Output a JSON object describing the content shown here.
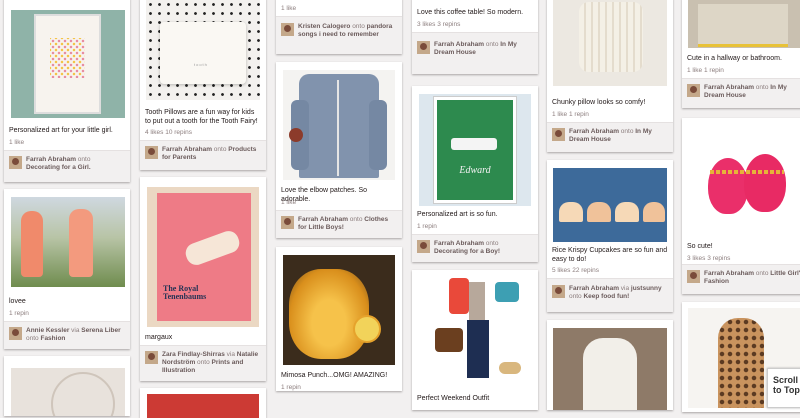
{
  "pins": {
    "p1": {
      "desc": "Personalized art for your little girl.",
      "stats": "1 like",
      "user": "Farrah Abraham",
      "onto": "onto",
      "board": "Decorating for a Girl."
    },
    "p2": {
      "desc": "lovee",
      "stats": "1 repin",
      "user": "Annie Kessler",
      "via": "via",
      "user2": "Serena Liber",
      "onto": "onto",
      "board": "Fashion"
    },
    "p3": {
      "desc": "Tooth Pillows are a fun way for kids to put out a tooth for the Tooth Fairy!",
      "stats": "4 likes   10 repins",
      "user": "Farrah Abraham",
      "onto": "onto",
      "board": "Products for Parents",
      "pillow_text": "tooth"
    },
    "p4": {
      "desc": "margaux",
      "user": "Zara Findlay-Shirras",
      "via": "via",
      "user2": "Natalie Nordström",
      "onto": "onto",
      "board": "Prints and Illustration",
      "poster_title": "The Royal Tenenbaums"
    },
    "p5": {
      "stats": "1 like",
      "user": "Kristen Calogero",
      "onto": "onto",
      "board": "pandora songs i need to remember"
    },
    "p6": {
      "desc": "Love the elbow patches. So adorable.",
      "stats": "1 like",
      "user": "Farrah Abraham",
      "onto": "onto",
      "board": "Clothes for Little Boys!"
    },
    "p7": {
      "desc": "Mimosa Punch...OMG! AMAZING!",
      "stats": "1 repin"
    },
    "p8": {
      "desc": "Love this coffee table! So modern.",
      "stats": "3 likes   3 repins",
      "user": "Farrah Abraham",
      "onto": "onto",
      "board": "In My Dream House"
    },
    "p9": {
      "desc": "Personalized art is so fun.",
      "stats": "1 repin",
      "user": "Farrah Abraham",
      "onto": "onto",
      "board": "Decorating for a Boy!",
      "art_text": "Edward"
    },
    "p10": {
      "desc": "Perfect Weekend Outfit"
    },
    "p11": {
      "desc": "Chunky pillow looks so comfy!",
      "stats": "1 like   1 repin",
      "user": "Farrah Abraham",
      "onto": "onto",
      "board": "In My Dream House"
    },
    "p12": {
      "desc": "Rice Krispy Cupcakes are so fun and easy to do!",
      "stats": "5 likes   22 repins",
      "user": "Farrah Abraham",
      "via": "via",
      "user2": "justsunny",
      "onto": "onto",
      "board": "Keep food fun!"
    },
    "p14": {
      "desc": "Cute in a hallway or bathroom.",
      "stats": "1 like   1 repin",
      "user": "Farrah Abraham",
      "onto": "onto",
      "board": "In My Dream House"
    },
    "p15": {
      "desc": "So cute!",
      "stats": "3 likes   3 repins",
      "user": "Farrah Abraham",
      "onto": "onto",
      "board": "Little Girl's Fashion"
    }
  },
  "scroll_to_top": "Scroll to Top"
}
